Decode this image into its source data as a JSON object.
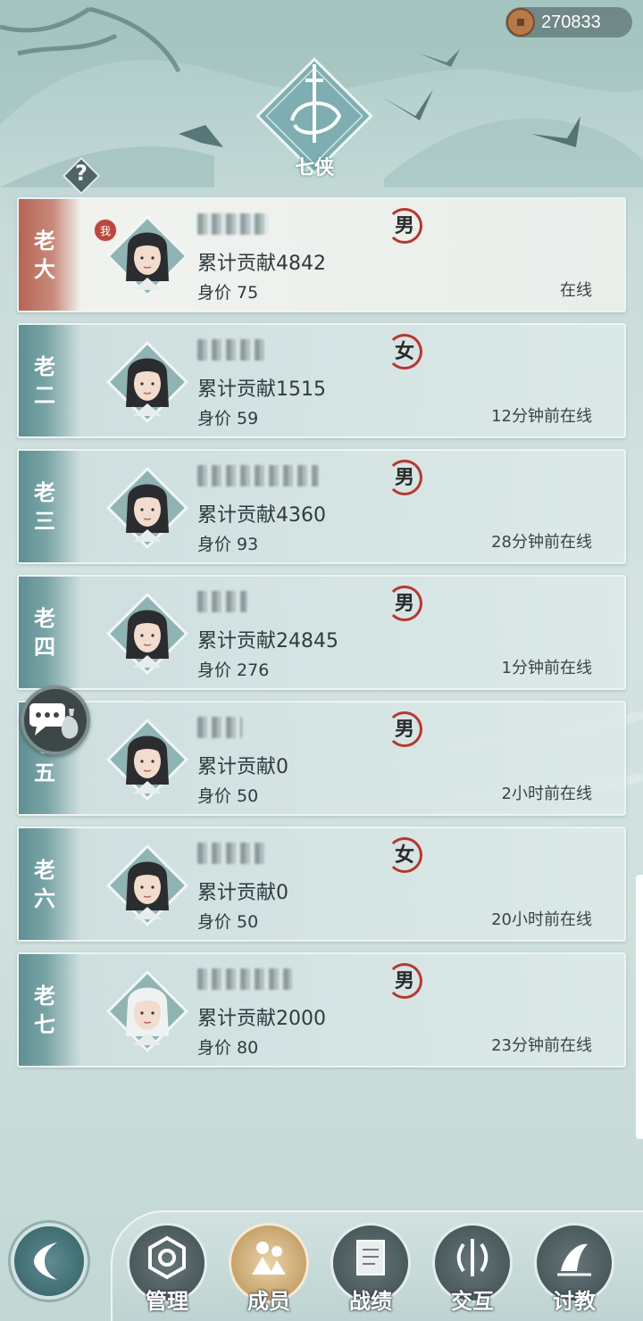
{
  "header": {
    "coin_amount": "270833",
    "emblem_title": "七侠",
    "help_label": "?"
  },
  "members": [
    {
      "rank": [
        "老",
        "大"
      ],
      "gender": "男",
      "contribution": "累计贡献4842",
      "worth": "身价 75",
      "status": "在线",
      "is_me": true,
      "me_badge": "我",
      "hair": "dark"
    },
    {
      "rank": [
        "老",
        "二"
      ],
      "gender": "女",
      "contribution": "累计贡献1515",
      "worth": "身价 59",
      "status": "12分钟前在线",
      "is_me": false,
      "hair": "dark-female"
    },
    {
      "rank": [
        "老",
        "三"
      ],
      "gender": "男",
      "contribution": "累计贡献4360",
      "worth": "身价 93",
      "status": "28分钟前在线",
      "is_me": false,
      "hair": "dark"
    },
    {
      "rank": [
        "老",
        "四"
      ],
      "gender": "男",
      "contribution": "累计贡献24845",
      "worth": "身价 276",
      "status": "1分钟前在线",
      "is_me": false,
      "hair": "dark-long"
    },
    {
      "rank": [
        "老",
        "五"
      ],
      "gender": "男",
      "contribution": "累计贡献0",
      "worth": "身价 50",
      "status": "2小时前在线",
      "is_me": false,
      "hair": "dark"
    },
    {
      "rank": [
        "老",
        "六"
      ],
      "gender": "女",
      "contribution": "累计贡献0",
      "worth": "身价 50",
      "status": "20小时前在线",
      "is_me": false,
      "hair": "dark-female"
    },
    {
      "rank": [
        "老",
        "七"
      ],
      "gender": "男",
      "contribution": "累计贡献2000",
      "worth": "身价 80",
      "status": "23分钟前在线",
      "is_me": false,
      "hair": "white"
    }
  ],
  "nav": [
    {
      "label": "管理",
      "icon": "manage-icon",
      "active": false
    },
    {
      "label": "成员",
      "icon": "members-icon",
      "active": true
    },
    {
      "label": "战绩",
      "icon": "record-icon",
      "active": false
    },
    {
      "label": "交互",
      "icon": "interact-icon",
      "active": false
    },
    {
      "label": "讨教",
      "icon": "spar-icon",
      "active": false
    }
  ],
  "colors": {
    "accent": "#5e8f93",
    "me_tab": "#b76456",
    "gender_ring": "#b6372f",
    "active_nav": "#c7a36b"
  }
}
